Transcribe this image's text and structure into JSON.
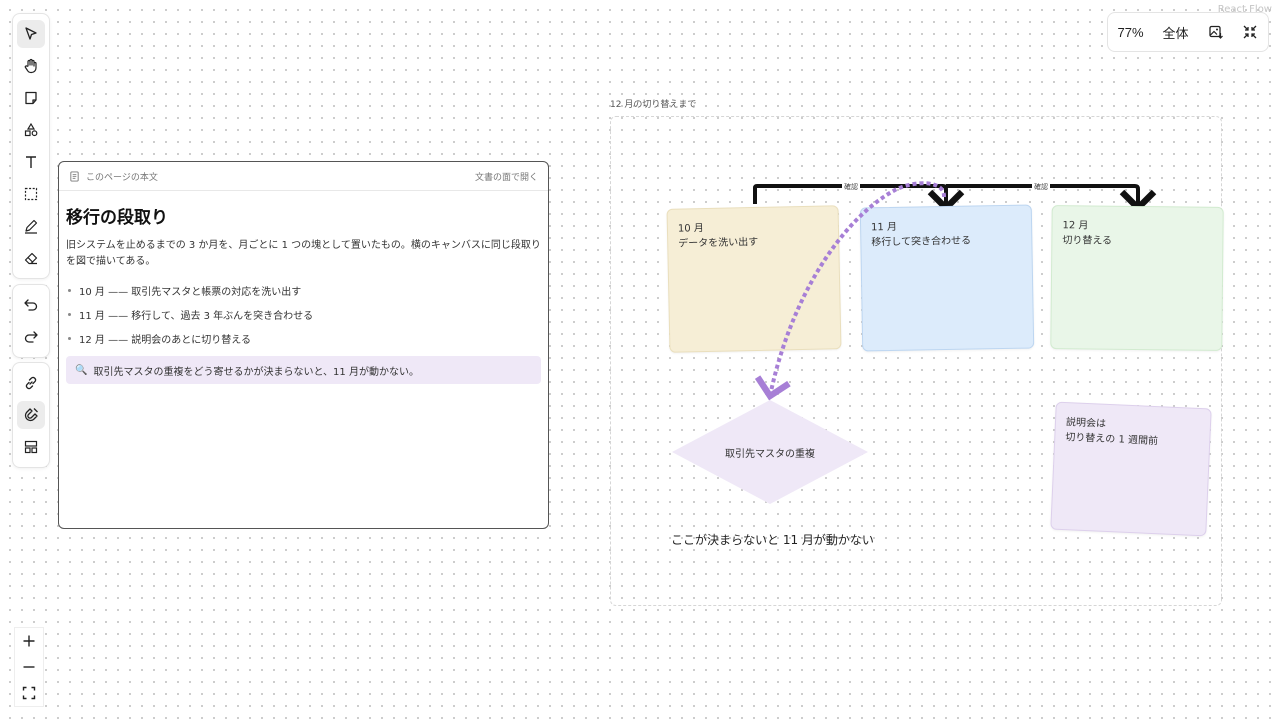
{
  "watermark": "React Flow",
  "toolbar": {
    "tools": [
      {
        "name": "select-tool",
        "icon": "pointer-icon"
      },
      {
        "name": "hand-tool",
        "icon": "hand-icon"
      },
      {
        "name": "sticky-tool",
        "icon": "sticky-note-icon"
      },
      {
        "name": "shapes-tool",
        "icon": "shapes-icon"
      },
      {
        "name": "text-tool",
        "icon": "text-icon"
      },
      {
        "name": "frame-tool",
        "icon": "frame-icon"
      },
      {
        "name": "pen-tool",
        "icon": "pen-icon"
      },
      {
        "name": "eraser-tool",
        "icon": "eraser-icon"
      }
    ],
    "history": [
      {
        "name": "undo-button",
        "icon": "undo-icon"
      },
      {
        "name": "redo-button",
        "icon": "redo-icon"
      }
    ],
    "extras": [
      {
        "name": "link-button",
        "icon": "link-icon"
      },
      {
        "name": "magnet-button",
        "icon": "magnet-icon"
      },
      {
        "name": "layout-button",
        "icon": "layout-icon"
      }
    ]
  },
  "zoom_controls": [
    {
      "name": "zoom-in-button",
      "icon": "plus-icon"
    },
    {
      "name": "zoom-out-button",
      "icon": "minus-icon"
    },
    {
      "name": "fit-view-button",
      "icon": "fit-view-icon"
    }
  ],
  "topbar": {
    "zoom_level": "77%",
    "fit_label": "全体",
    "export_icon": "image-export-icon",
    "collapse_icon": "collapse-icon"
  },
  "document": {
    "header_label": "このページの本文",
    "open_link": "文書の面で開く",
    "title": "移行の段取り",
    "paragraph": "旧システムを止めるまでの 3 か月を、月ごとに 1 つの塊として置いたもの。横のキャンバスに同じ段取りを図で描いてある。",
    "items": [
      "10 月 —— 取引先マスタと帳票の対応を洗い出す",
      "11 月 —— 移行して、過去 3 年ぶんを突き合わせる",
      "12 月 —— 説明会のあとに切り替える"
    ],
    "callout_icon": "magnifier-icon",
    "callout": "取引先マスタの重複をどう寄せるかが決まらないと、11 月が動かない。"
  },
  "canvas": {
    "frame_label": "12 月の切り替えまで",
    "notes": [
      {
        "title": "10 月",
        "body": "データを洗い出す",
        "color": "#f6eed6"
      },
      {
        "title": "11 月",
        "body": "移行して突き合わせる",
        "color": "#dcebfb"
      },
      {
        "title": "12 月",
        "body": "切り替える",
        "color": "#e9f6e8"
      },
      {
        "title": "説明会は",
        "body": "切り替えの 1 週間前",
        "color": "#efe8f7"
      }
    ],
    "edge_labels": [
      "確認",
      "確認"
    ],
    "diamond_label": "取引先マスタの重複",
    "diamond_color": "#efe8f7",
    "caption": "ここが決まらないと 11 月が動かない",
    "accent_purple": "#a77fd6"
  }
}
